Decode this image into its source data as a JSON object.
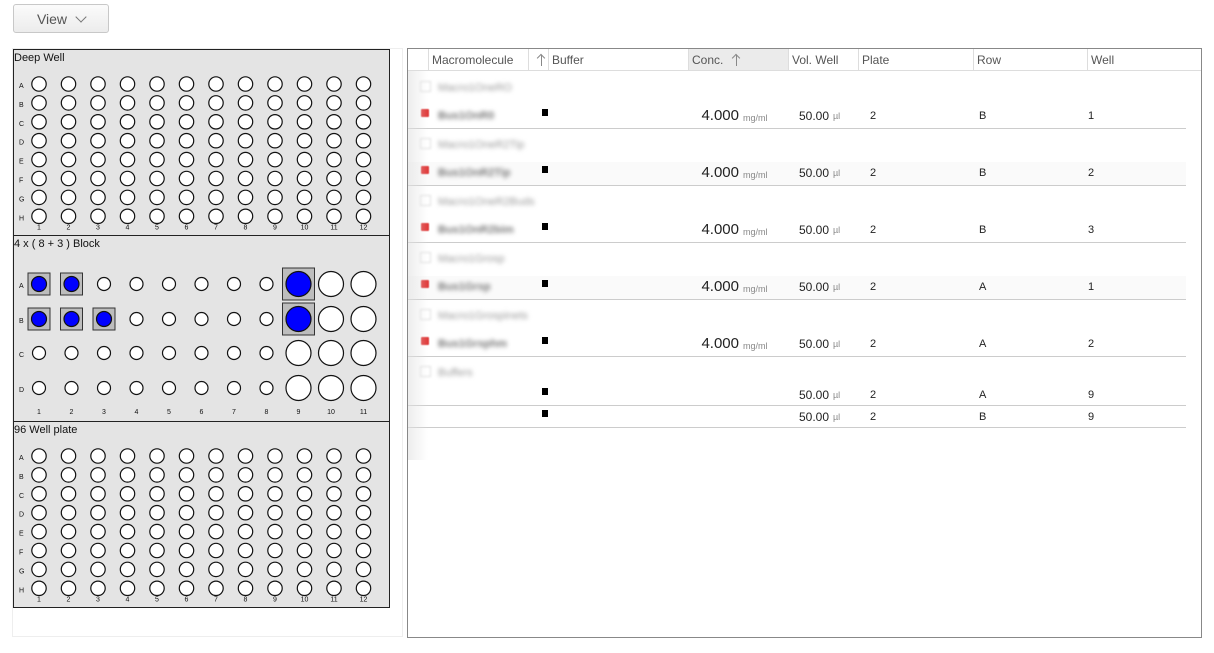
{
  "toolbar": {
    "view_label": "View"
  },
  "plates": [
    {
      "title": "Deep Well",
      "rows": [
        "A",
        "B",
        "C",
        "D",
        "E",
        "F",
        "G",
        "H"
      ],
      "cols": [
        "1",
        "2",
        "3",
        "4",
        "5",
        "6",
        "7",
        "8",
        "9",
        "10",
        "11",
        "12"
      ]
    },
    {
      "title": "4 x ( 8 + 3 ) Block",
      "rows": [
        "A",
        "B",
        "C",
        "D"
      ],
      "cols": [
        "1",
        "2",
        "3",
        "4",
        "5",
        "6",
        "7",
        "8",
        "9",
        "10",
        "11"
      ],
      "filled": [
        "A1",
        "A2",
        "B1",
        "B2",
        "B3",
        "A9",
        "B9"
      ],
      "selected": [
        "A1",
        "A2",
        "B1",
        "B2",
        "B3",
        "A9",
        "B9"
      ]
    },
    {
      "title": "96 Well plate",
      "rows": [
        "A",
        "B",
        "C",
        "D",
        "E",
        "F",
        "G",
        "H"
      ],
      "cols": [
        "1",
        "2",
        "3",
        "4",
        "5",
        "6",
        "7",
        "8",
        "9",
        "10",
        "11",
        "12"
      ]
    }
  ],
  "colors": {
    "fill": "#0000ff",
    "select_bg": "#bdbdbd",
    "plate_bg": "#e4e4e4",
    "marker": "#e03a3a"
  },
  "table": {
    "headers": {
      "macromolecule": "Macromolecule",
      "buffer": "Buffer",
      "conc": "Conc.",
      "vol": "Vol. Well",
      "plate": "Plate",
      "row": "Row",
      "well": "Well"
    },
    "groups": [
      {
        "label": "Macro1OneRO"
      },
      {
        "label": "Macro1OneR2Tip"
      },
      {
        "label": "Macro1OneR2Buds"
      },
      {
        "label": "Macro1Grosp"
      },
      {
        "label": "Macro1Grospinets"
      },
      {
        "label": "Buffers"
      }
    ],
    "rows": [
      {
        "name": "Bus1OnR0",
        "conc": "4.000",
        "conc_unit": "mg/ml",
        "vol": "50.00",
        "vol_unit": "µl",
        "plate": "2",
        "row": "B",
        "well": "1"
      },
      {
        "name": "Bus1OnR2Tip",
        "conc": "4.000",
        "conc_unit": "mg/ml",
        "vol": "50.00",
        "vol_unit": "µl",
        "plate": "2",
        "row": "B",
        "well": "2"
      },
      {
        "name": "Bus1OnR2bim",
        "conc": "4.000",
        "conc_unit": "mg/ml",
        "vol": "50.00",
        "vol_unit": "µl",
        "plate": "2",
        "row": "B",
        "well": "3"
      },
      {
        "name": "Bus1Grsp",
        "conc": "4.000",
        "conc_unit": "mg/ml",
        "vol": "50.00",
        "vol_unit": "µl",
        "plate": "2",
        "row": "A",
        "well": "1"
      },
      {
        "name": "Bus1Grsphm",
        "conc": "4.000",
        "conc_unit": "mg/ml",
        "vol": "50.00",
        "vol_unit": "µl",
        "plate": "2",
        "row": "A",
        "well": "2"
      },
      {
        "name": "",
        "conc": "",
        "conc_unit": "",
        "vol": "50.00",
        "vol_unit": "µl",
        "plate": "2",
        "row": "A",
        "well": "9"
      },
      {
        "name": "",
        "conc": "",
        "conc_unit": "",
        "vol": "50.00",
        "vol_unit": "µl",
        "plate": "2",
        "row": "B",
        "well": "9"
      }
    ]
  }
}
